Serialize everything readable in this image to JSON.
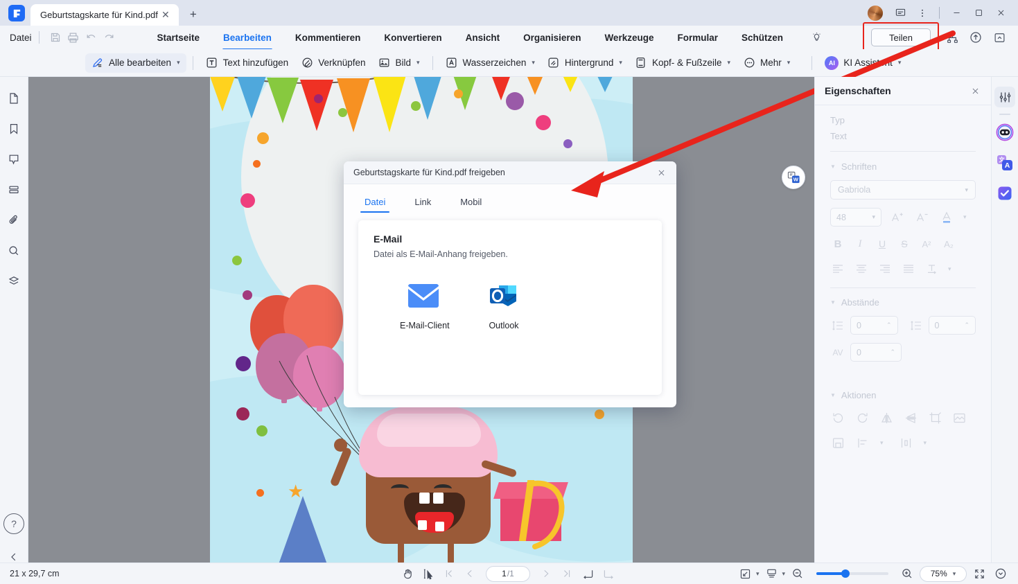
{
  "window": {
    "app_icon": "pdf-app-logo",
    "tab_title": "Geburtstagskarte für Kind.pdf",
    "new_tab_label": "+",
    "close_tab_label": "✕",
    "titlebar_icons": [
      "avatar",
      "feedback-icon",
      "more-vertical-icon"
    ],
    "minimize": "—",
    "maximize": "▢",
    "close": "✕"
  },
  "menubar": {
    "file_label": "Datei",
    "quick_icons": [
      "save-icon",
      "print-icon",
      "undo-icon",
      "redo-icon"
    ],
    "items": [
      {
        "label": "Startseite",
        "active": false
      },
      {
        "label": "Bearbeiten",
        "active": true
      },
      {
        "label": "Kommentieren",
        "active": false
      },
      {
        "label": "Konvertieren",
        "active": false
      },
      {
        "label": "Ansicht",
        "active": false
      },
      {
        "label": "Organisieren",
        "active": false
      },
      {
        "label": "Werkzeuge",
        "active": false
      },
      {
        "label": "Formular",
        "active": false
      },
      {
        "label": "Schützen",
        "active": false
      }
    ],
    "bulb_icon": "lightbulb-icon",
    "share_label": "Teilen",
    "right_icons": [
      "share-network-icon",
      "cloud-upload-icon",
      "collapse-ribbon-icon"
    ],
    "highlight_color": "#e8241c",
    "accent_color": "#1a73f0"
  },
  "ribbon": {
    "items": [
      {
        "label": "Alle bearbeiten",
        "icon": "edit-all-icon",
        "caret": true
      },
      {
        "label": "Text hinzufügen",
        "icon": "add-text-icon",
        "caret": false
      },
      {
        "label": "Verknüpfen",
        "icon": "link-icon",
        "caret": false
      },
      {
        "label": "Bild",
        "icon": "image-icon",
        "caret": true
      },
      {
        "label": "Wasserzeichen",
        "icon": "watermark-icon",
        "caret": true
      },
      {
        "label": "Hintergrund",
        "icon": "background-icon",
        "caret": true
      },
      {
        "label": "Kopf- & Fußzeile",
        "icon": "header-footer-icon",
        "caret": true
      },
      {
        "label": "Mehr",
        "icon": "more-icon",
        "caret": true
      }
    ],
    "ai_badge": "AI",
    "ai_label": "KI Assistent"
  },
  "left_rail": {
    "icons": [
      "page-thumbnails-icon",
      "bookmark-icon",
      "comment-icon",
      "list-layers-icon",
      "attachment-icon",
      "search-icon",
      "stamp-layers-icon"
    ],
    "help_label": "?",
    "collapse_icon": "chevron-left-icon"
  },
  "document": {
    "word_badge": "convert-to-word-icon",
    "page_background": "#cdeef6"
  },
  "dialog": {
    "title": "Geburtstagskarte für Kind.pdf freigeben",
    "close_label": "✕",
    "tabs": [
      {
        "label": "Datei",
        "active": true
      },
      {
        "label": "Link",
        "active": false
      },
      {
        "label": "Mobil",
        "active": false
      }
    ],
    "card": {
      "heading": "E-Mail",
      "subtitle": "Datei als E-Mail-Anhang freigeben.",
      "apps": [
        {
          "label": "E-Mail-Client",
          "icon": "mail-envelope-icon"
        },
        {
          "label": "Outlook",
          "icon": "outlook-icon"
        }
      ]
    }
  },
  "properties": {
    "title": "Eigenschaften",
    "close_label": "✕",
    "type_label": "Typ",
    "type_value": "Text",
    "fonts_section": "Schriften",
    "font_family": "Gabriola",
    "font_size": "48",
    "font_buttons": [
      "increase-font-icon",
      "decrease-font-icon",
      "font-color-icon"
    ],
    "style_buttons": [
      "bold-icon",
      "italic-icon",
      "underline-icon",
      "strikethrough-icon",
      "superscript-icon",
      "subscript-icon"
    ],
    "align_buttons": [
      "align-left-icon",
      "align-center-icon",
      "align-right-icon",
      "align-justify-icon",
      "text-direction-icon"
    ],
    "spacing_section": "Abstände",
    "line_spacing_value": "0",
    "paragraph_spacing_value": "0",
    "char_spacing_label": "AV",
    "char_spacing_value": "0",
    "actions_section": "Aktionen",
    "action_buttons": [
      "rotate-left-icon",
      "rotate-right-icon",
      "flip-horizontal-icon",
      "flip-vertical-icon",
      "crop-icon",
      "replace-image-icon"
    ],
    "action_buttons_row2": [
      "save-image-icon",
      "align-objects-icon",
      "distribute-objects-icon"
    ]
  },
  "right_rail": {
    "selected_icon": "properties-sliders-icon",
    "icons": [
      "ai-robot-icon",
      "translate-icon",
      "checklist-icon"
    ]
  },
  "statusbar": {
    "dimensions": "21 x 29,7 cm",
    "tools": [
      "hand-tool-icon",
      "select-tool-icon"
    ],
    "nav": [
      "first-page-icon",
      "prev-page-icon",
      "next-page-icon",
      "last-page-icon"
    ],
    "page_current": "1",
    "page_total": "/1",
    "view_icons": [
      "fit-page-icon",
      "continuous-scroll-icon"
    ],
    "zoom_out_icon": "zoom-out-icon",
    "zoom_in_icon": "zoom-in-icon",
    "zoom_value": "75%",
    "fullscreen_icon": "fullscreen-icon",
    "expand_icon": "chevron-down-circle-icon",
    "page_layout_icon": "page-layout-icon",
    "scroll_mode_icon": "scroll-mode-icon"
  }
}
